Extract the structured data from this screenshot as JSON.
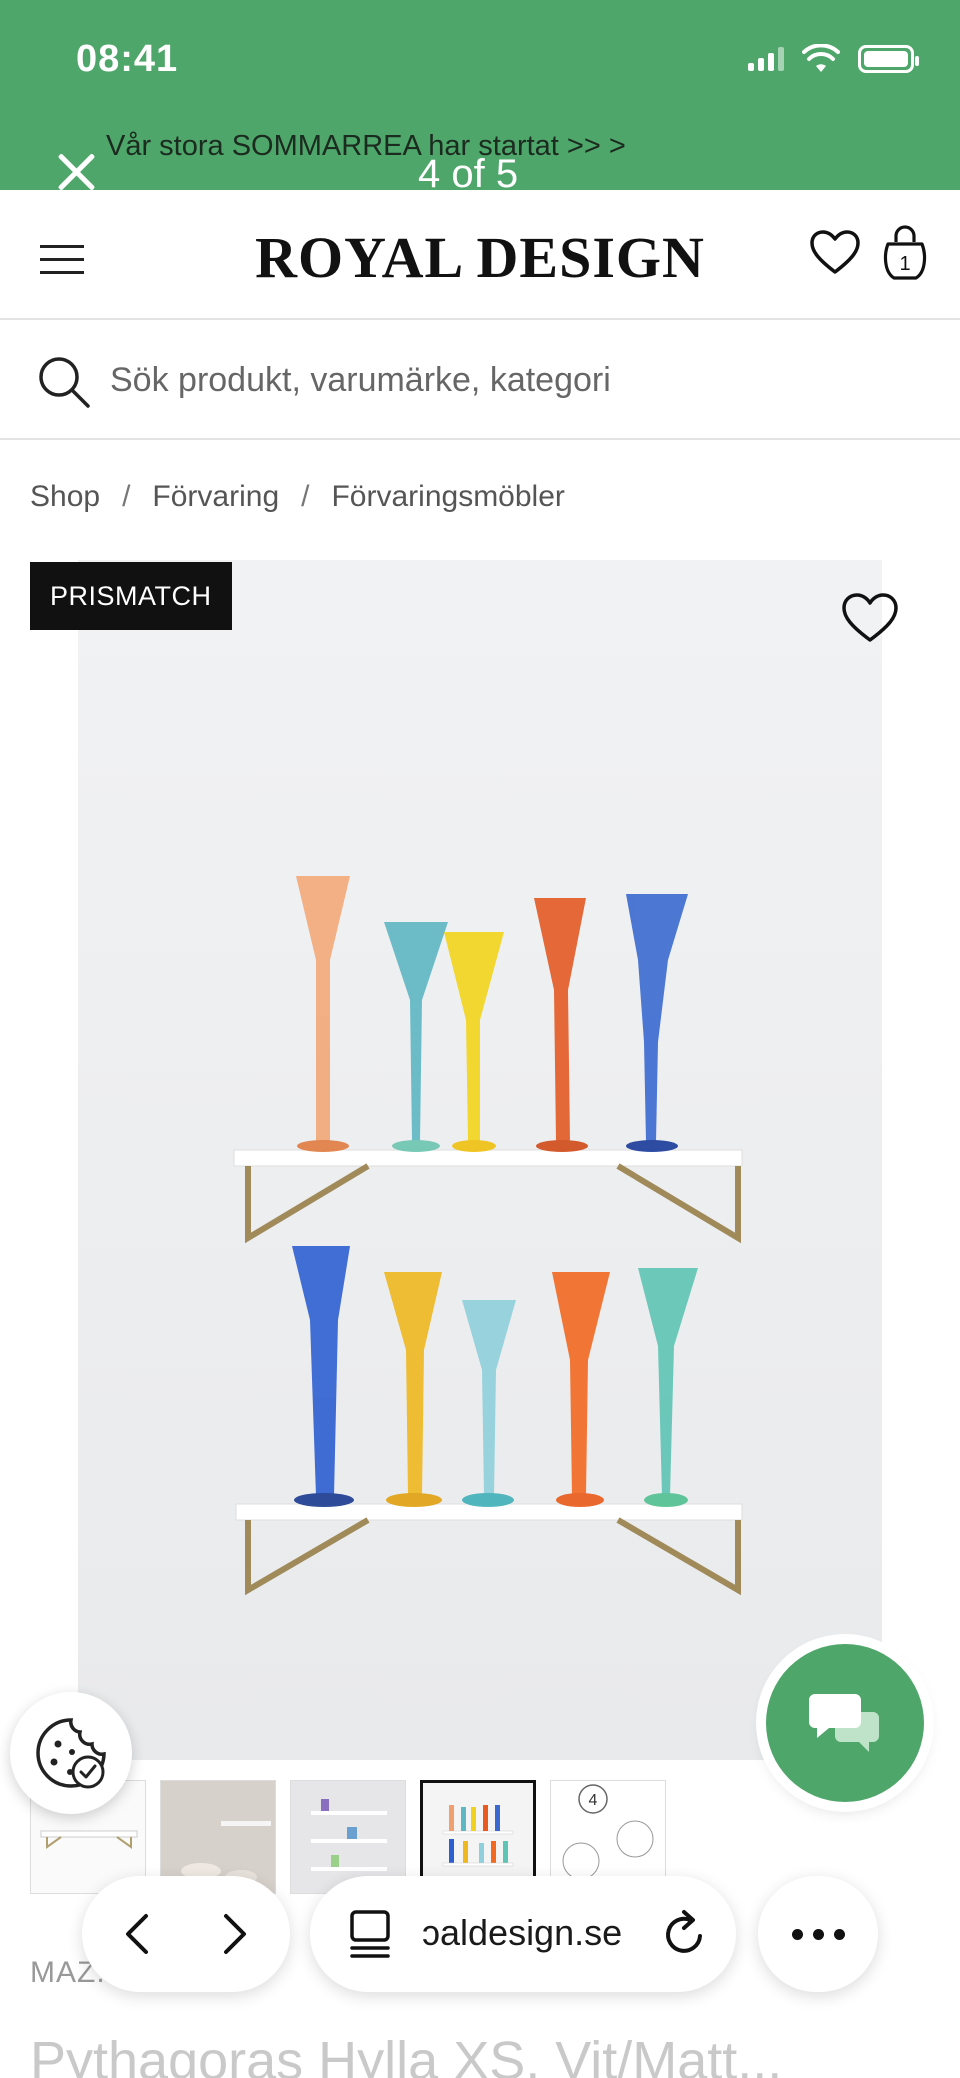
{
  "status_bar": {
    "time": "08:41"
  },
  "banner": {
    "promo_text": "Vår stora SOMMARREA har startat >> >",
    "counter": "4 of 5"
  },
  "header": {
    "logo": "ROYAL DESIGN"
  },
  "search": {
    "placeholder": "Sök produkt, varumärke, kategori"
  },
  "breadcrumb": [
    "Shop",
    "Förvaring",
    "Förvaringsmöbler"
  ],
  "breadcrumb_separator": "/",
  "product": {
    "badge": "PRISMATCH",
    "brand": "MAZ...",
    "title": "Pythagoras Hylla XS, Vit/Matt..."
  },
  "gallery": {
    "thumbnail_count": 5,
    "active_index": 4
  },
  "browser": {
    "url": "ɔaldesign.se"
  },
  "colors": {
    "brand_green": "#4fa66a",
    "glass_colors": [
      "#f0a070",
      "#4fb0c0",
      "#f0d020",
      "#e85a20",
      "#3a6ad0",
      "#2a5ad0",
      "#e8b020",
      "#6ec0d0",
      "#f06a20",
      "#5ac0b0"
    ]
  },
  "icons": [
    "close-icon",
    "hamburger-icon",
    "heart-icon",
    "bag-icon",
    "search-icon",
    "cookie-icon",
    "chat-icon",
    "chevron-left-icon",
    "chevron-right-icon",
    "tabs-icon",
    "reload-icon",
    "more-icon"
  ]
}
